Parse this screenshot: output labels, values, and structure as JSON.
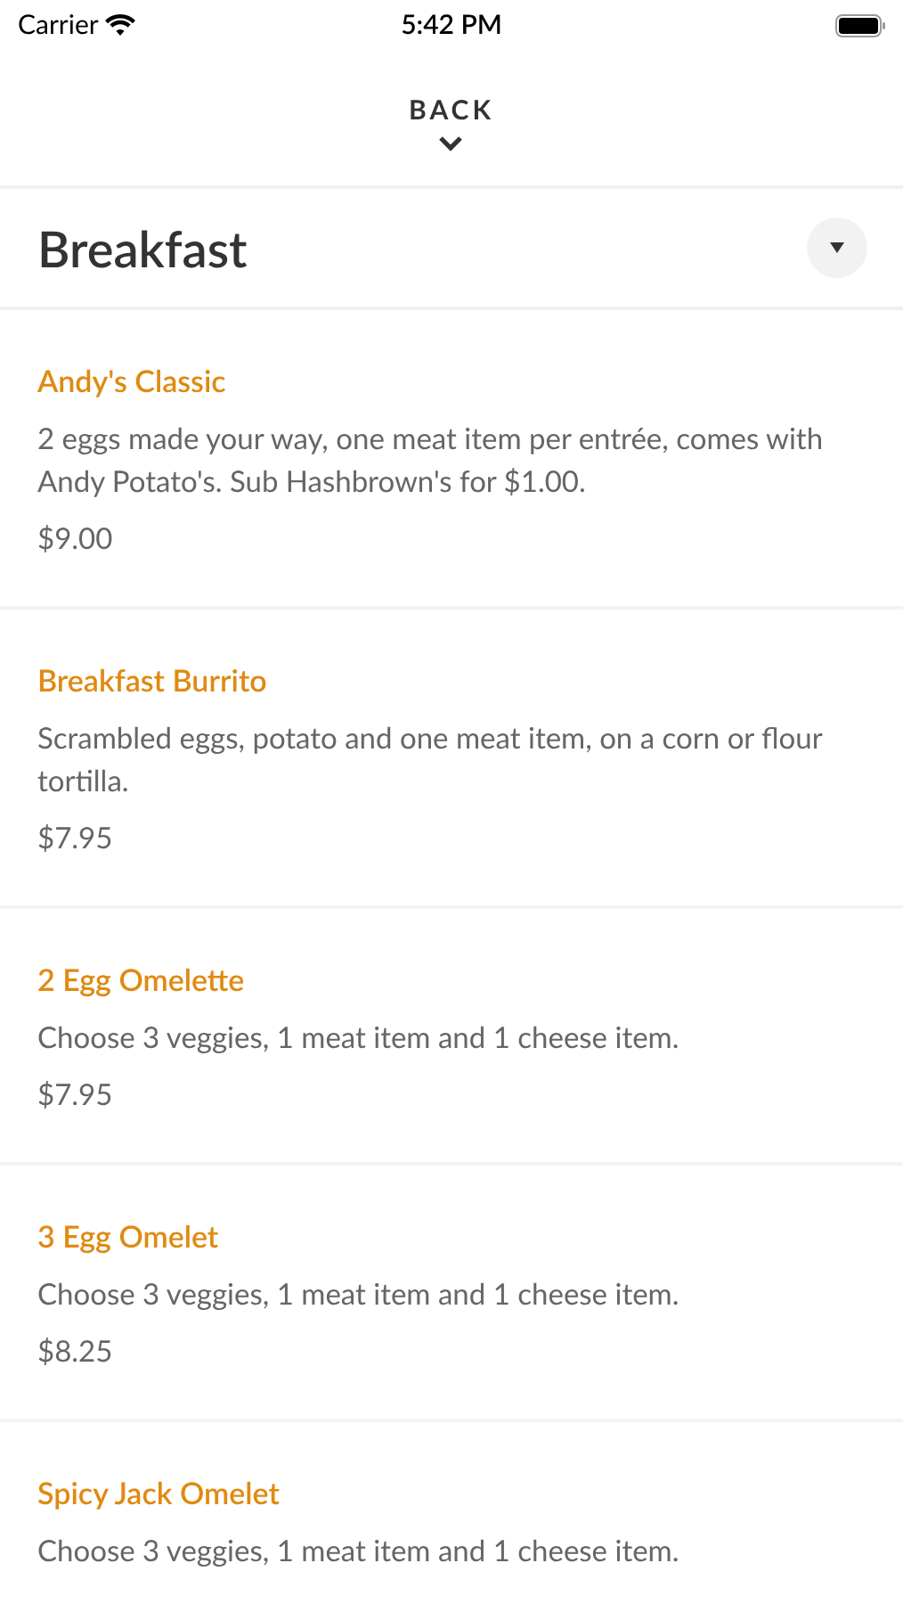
{
  "status_bar": {
    "carrier": "Carrier",
    "time": "5:42 PM"
  },
  "back": {
    "label": "BACK"
  },
  "section": {
    "title": "Breakfast",
    "expanded": true
  },
  "items": [
    {
      "name": "Andy's Classic",
      "description": "2 eggs made your way, one meat item per entrée, comes with Andy Potato's. Sub Hashbrown's for $1.00.",
      "price": "$9.00"
    },
    {
      "name": "Breakfast Burrito",
      "description": "Scrambled eggs, potato and one meat item, on a corn or flour tortilla.",
      "price": "$7.95"
    },
    {
      "name": "2 Egg Omelette",
      "description": "Choose 3 veggies, 1 meat item and 1 cheese item.",
      "price": "$7.95"
    },
    {
      "name": "3 Egg Omelet",
      "description": "Choose 3 veggies, 1 meat item and 1 cheese item.",
      "price": "$8.25"
    },
    {
      "name": "Spicy Jack Omelet",
      "description": "Choose 3 veggies, 1 meat item and 1 cheese item."
    }
  ]
}
